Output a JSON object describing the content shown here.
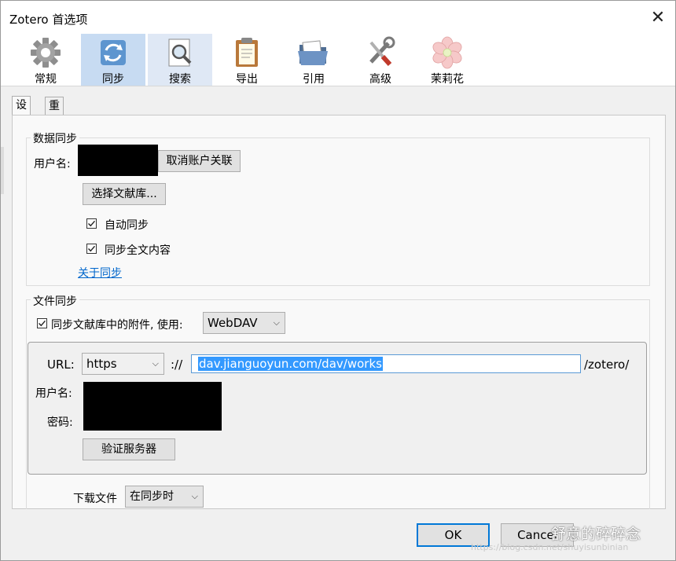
{
  "window": {
    "title": "Zotero 首选项",
    "close_glyph": "✕"
  },
  "toolbar": {
    "items": [
      {
        "label": "常规",
        "icon": "gear-icon"
      },
      {
        "label": "同步",
        "icon": "sync-icon"
      },
      {
        "label": "搜索",
        "icon": "search-icon"
      },
      {
        "label": "导出",
        "icon": "clipboard-icon"
      },
      {
        "label": "引用",
        "icon": "folder-icon"
      },
      {
        "label": "高级",
        "icon": "tools-icon"
      },
      {
        "label": "茉莉花",
        "icon": "flower-icon"
      }
    ],
    "selected": "同步"
  },
  "tabs": [
    {
      "label": "设置",
      "active": true
    },
    {
      "label": "重置",
      "active": false
    }
  ],
  "data_sync": {
    "group_label": "数据同步",
    "username_label": "用户名:",
    "unlink_button": "取消账户关联",
    "choose_library_button": "选择文献库...",
    "auto_sync_label": "自动同步",
    "auto_sync_checked": true,
    "fulltext_label": "同步全文内容",
    "fulltext_checked": true,
    "about_link": "关于同步"
  },
  "file_sync": {
    "group_label": "文件同步",
    "attachments_label": "同步文献库中的附件, 使用:",
    "attachments_checked": true,
    "method": "WebDAV",
    "url_label": "URL:",
    "protocol": "https",
    "separator": "://",
    "url_value": "dav.jianguoyun.com/dav/works",
    "url_suffix": "/zotero/",
    "username_label": "用户名:",
    "password_label": "密码:",
    "verify_button": "验证服务器",
    "download_label": "下载文件",
    "download_value": "在同步时"
  },
  "footer": {
    "ok": "OK",
    "cancel": "Cancel"
  },
  "watermark": {
    "text": "舒意的碎碎念",
    "url": "https://blog.csdn.net/shuyisunbinian"
  },
  "colors": {
    "selected_tab": "#c7dbf2",
    "link": "#0066cc",
    "ok_border": "#0078d7",
    "url_selection": "#3399ff"
  }
}
